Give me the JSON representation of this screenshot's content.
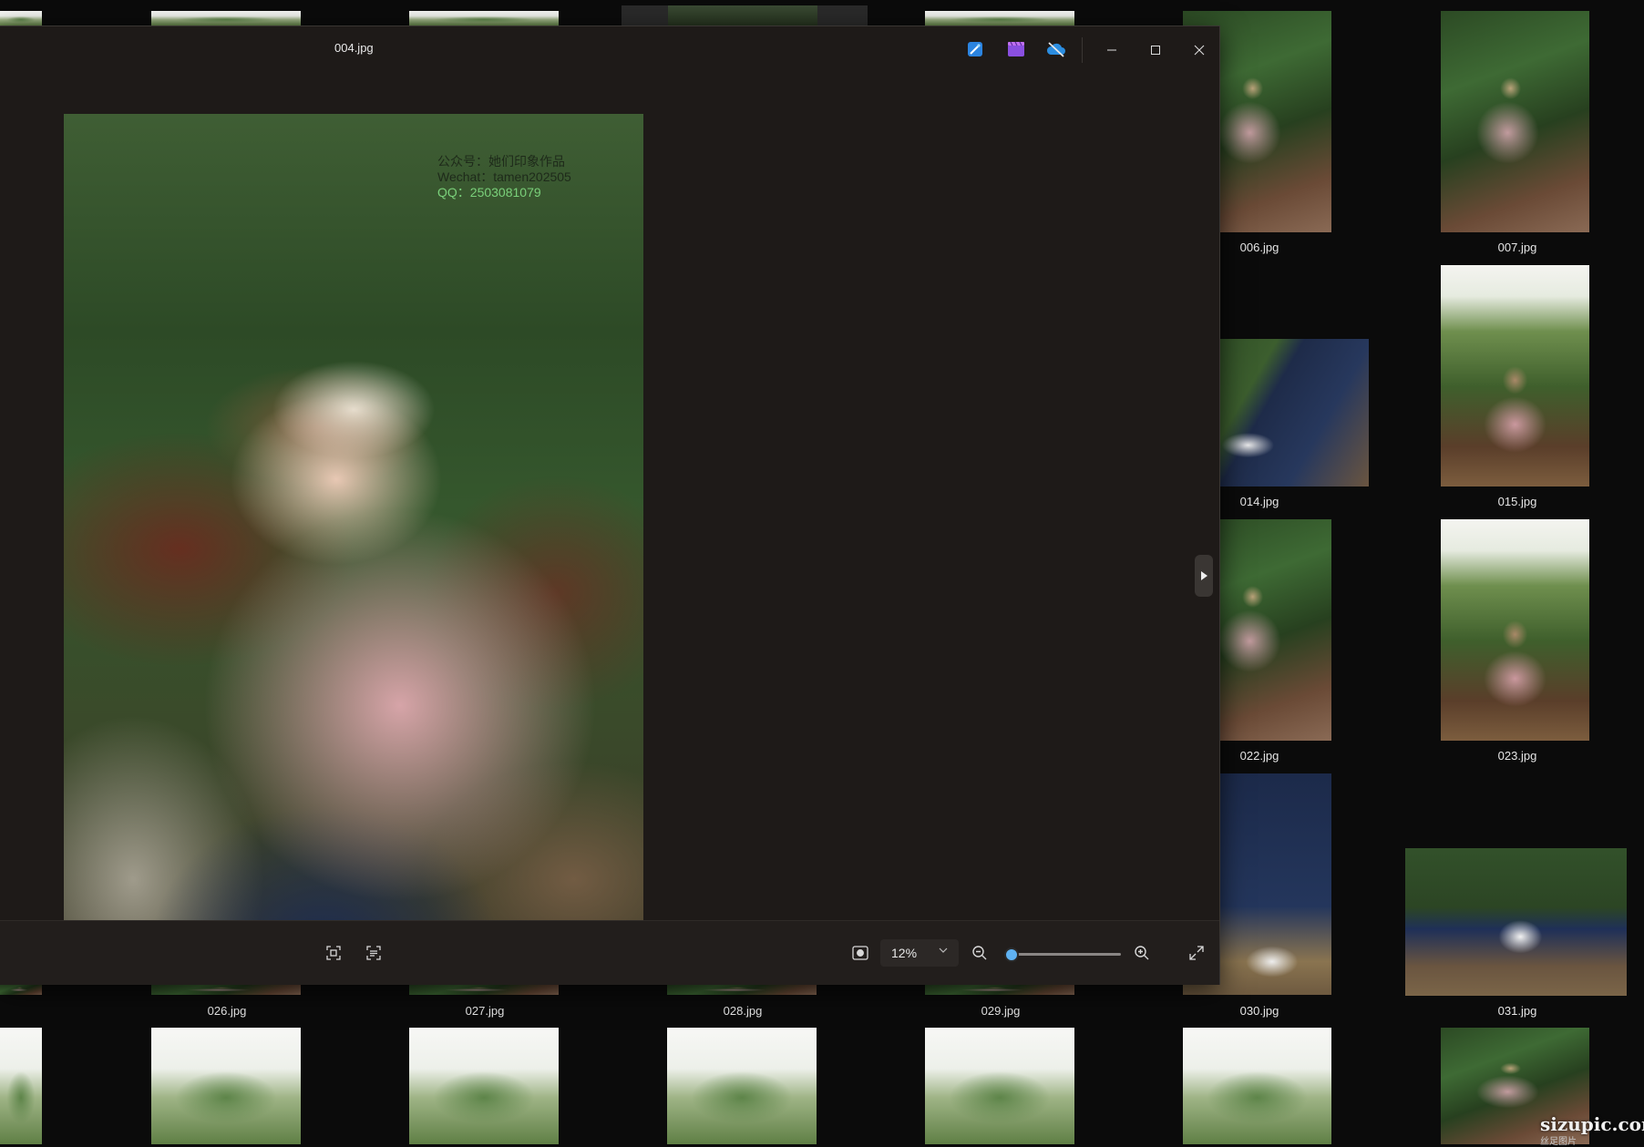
{
  "window": {
    "title": "004.jpg"
  },
  "photo": {
    "watermark_line1": "公众号：她们印象作品",
    "watermark_line2": "Wechat：tamen202505",
    "watermark_line3": "QQ：2503081079"
  },
  "toolbar": {
    "zoom": "12%"
  },
  "thumbnails": {
    "row1": [
      "006.jpg",
      "007.jpg"
    ],
    "row2": [
      "014.jpg",
      "015.jpg"
    ],
    "row3": [
      "022.jpg",
      "023.jpg"
    ],
    "row4": [
      "026.jpg",
      "027.jpg",
      "028.jpg",
      "029.jpg",
      "030.jpg",
      "031.jpg"
    ]
  },
  "site_watermark": {
    "main": "sizupic.com",
    "sub": "丝足图片"
  },
  "colors": {
    "accent": "#5fb2f2",
    "window_bg": "#1e1a18",
    "page_bg": "#0b0b0b"
  }
}
